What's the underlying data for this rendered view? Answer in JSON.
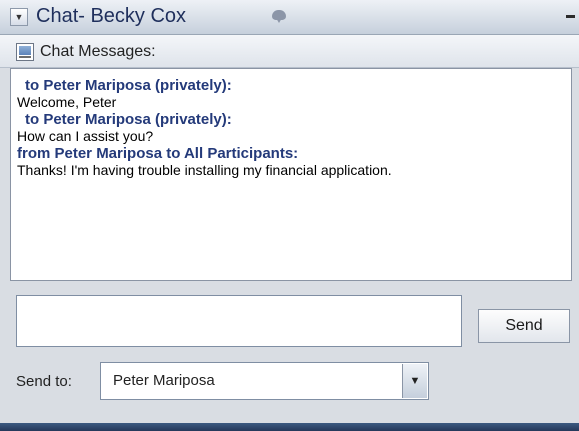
{
  "window": {
    "title": "Chat- Becky Cox",
    "collapse_icon": "▼",
    "pin_icon": "pin-icon"
  },
  "panel": {
    "title": "Chat Messages:",
    "icon": "chat-window-icon"
  },
  "messages": [
    {
      "header": "to Peter Mariposa  (privately):",
      "body": "Welcome, Peter",
      "indented": true
    },
    {
      "header": "to Peter Mariposa  (privately):",
      "body": "How can I assist you?",
      "indented": true
    },
    {
      "header": "from Peter Mariposa to All Participants:",
      "body": "Thanks!  I'm having trouble installing my financial application.",
      "indented": false
    }
  ],
  "composer": {
    "input_value": "",
    "send_label": "Send"
  },
  "send_to": {
    "label": "Send to:",
    "selected": "Peter Mariposa",
    "dropdown_icon": "▼"
  },
  "colors": {
    "header_text": "#243a7a",
    "title_text": "#1f2f5c"
  }
}
